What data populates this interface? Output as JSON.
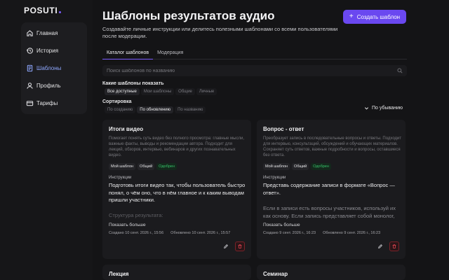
{
  "app": {
    "logo": "POSUTI"
  },
  "sidebar": {
    "items": [
      {
        "label": "Главная",
        "icon": "home-icon"
      },
      {
        "label": "История",
        "icon": "history-icon"
      },
      {
        "label": "Шаблоны",
        "icon": "templates-icon",
        "active": true
      },
      {
        "label": "Профиль",
        "icon": "profile-icon"
      },
      {
        "label": "Тарифы",
        "icon": "tariffs-icon"
      }
    ]
  },
  "header": {
    "title": "Шаблоны результатов аудио",
    "subtitle": "Создавайте личные инструкции или делитесь полезными шаблонами со всеми пользователями после модерации.",
    "create_label": "Создать шаблон"
  },
  "tabs": [
    {
      "label": "Каталог шаблонов",
      "active": true
    },
    {
      "label": "Модерация",
      "active": false
    }
  ],
  "search": {
    "placeholder": "Поиск шаблонов по названию"
  },
  "filters": {
    "show_label": "Какие шаблоны показать",
    "show_options": [
      "Все доступные",
      "Мои шаблоны",
      "Общие",
      "Личные"
    ],
    "show_selected": "Все доступные",
    "sort_label": "Сортировка",
    "sort_options": [
      "По созданию",
      "По обновлению",
      "По названию"
    ],
    "sort_selected": "По обновлению",
    "order_label": "По убыванию"
  },
  "cards": [
    {
      "title": "Итоги видео",
      "description": "Помогает понять суть видео без полного просмотра: главные мысли, важные факты, выводы и рекомендации автора. Подходит для лекций, обзоров, интервью, вебинаров и других познавательных видео.",
      "badges": [
        "Мой шаблон",
        "Общий",
        "Одобрен"
      ],
      "instructions_label": "Инструкции",
      "instructions_text": "Подготовь итоги видео так, чтобы пользователь быстро понял, о чём оно, что в нём главное и к каким выводам пришли участники.",
      "instructions_fade": "Структура результата:",
      "show_more": "Показать больше",
      "created": "Создано 10 сент. 2026 г., 15:56",
      "updated": "Обновлено 10 сент. 2026 г., 15:57"
    },
    {
      "title": "Вопрос - ответ",
      "description": "Преобразует запись в последовательные вопросы и ответы. Подходит для интервью, консультаций, обсуждений и обучающих материалов. Сохраняет суть ответов, важные подробности и вопросы, оставшиеся без ответа.",
      "badges": [
        "Мой шаблон",
        "Общий",
        "Одобрен"
      ],
      "instructions_label": "Инструкции",
      "instructions_text": "Представь содержание записи в формате «Вопрос — ответ».",
      "instructions_fade": "Если в записи есть вопросы участников, используй их как основу. Если запись представляет собой монолог,",
      "show_more": "Показать больше",
      "created": "Создано 9 сент. 2026 г., 16:23",
      "updated": "Обновлено 9 сент. 2026 г., 16:23"
    },
    {
      "title": "Лекция"
    },
    {
      "title": "Семинар"
    }
  ]
}
